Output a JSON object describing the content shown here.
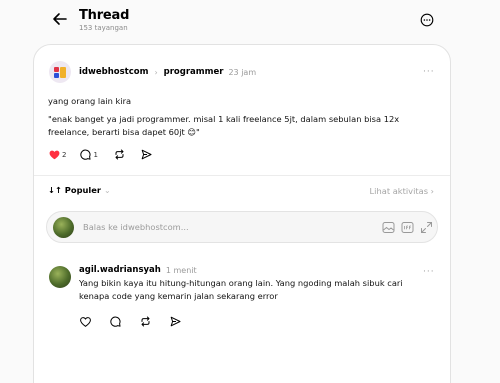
{
  "header": {
    "title": "Thread",
    "views": "153 tayangan"
  },
  "post": {
    "username": "idwebhostcom",
    "separator": "›",
    "topic": "programmer",
    "time": "23 jam",
    "more": "···",
    "line1": "yang orang lain kira",
    "quote_line1": "\"enak banget ya jadi programmer. misal 1 kali freelance 5jt, dalam sebulan bisa 12x",
    "quote_line2": "freelance, berarti bisa dapet 60jt 😊\"",
    "likes": "2",
    "replies": "1"
  },
  "sort": {
    "label": "↓↑ Populer",
    "chevron": "⌄",
    "activity": "Lihat aktivitas ›"
  },
  "reply_box": {
    "placeholder": "Balas ke idwebhostcom..."
  },
  "comment": {
    "username": "agil.wadriansyah",
    "time": "1 menit",
    "more": "···",
    "text": "Yang bikin kaya itu hitung-hitungan orang lain. Yang ngoding malah sibuk cari kenapa code yang kemarin jalan sekarang error"
  },
  "colors": {
    "like_red": "#ff3040",
    "muted": "#9a9a9a",
    "border": "#e2e2e2"
  },
  "icons": [
    "back-arrow-icon",
    "more-circle-icon",
    "heart-icon",
    "comment-icon",
    "repost-icon",
    "share-icon",
    "image-icon",
    "gif-icon",
    "expand-icon"
  ]
}
